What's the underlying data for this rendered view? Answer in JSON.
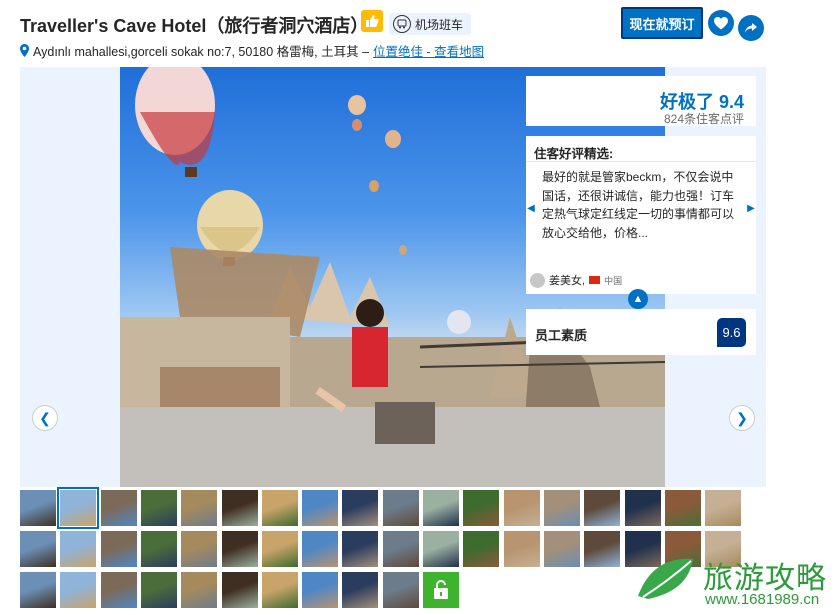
{
  "header": {
    "title": "Traveller's Cave Hotel（旅行者洞穴酒店）",
    "shuttle_label": "机场班车",
    "address": "Aydınlı mahallesi,gorceli sokak no:7, 50180 格雷梅, 土耳其 –",
    "address_link": "位置绝佳 - 查看地图",
    "book_button": "现在就预订"
  },
  "review_panel": {
    "score_label": "好极了 9.4",
    "review_count": "824条住客点评",
    "featured_heading": "住客好评精选:",
    "review_text": "最好的就是管家beckm，不仅会说中国话，还很讲诚信，能力也强！订车定热气球定红线定一切的事情都可以放心交给他，价格...",
    "reviewer_name": "姜美女,",
    "reviewer_country": "中国",
    "staff_label": "员工素质",
    "staff_score": "9.6"
  },
  "icons": [
    "thumbs-up-icon",
    "bus-icon",
    "location-pin-icon",
    "heart-icon",
    "share-icon",
    "chevron-left-icon",
    "chevron-right-icon",
    "chevron-up-icon",
    "lock-icon",
    "avatar-icon",
    "china-flag-icon"
  ],
  "colors": {
    "accent": "#0071c2",
    "dark_blue": "#003580",
    "badge_yellow": "#febb02",
    "lock_green": "#3eb32e",
    "panel_bg": "#ebf3ff"
  },
  "watermark": {
    "text": "旅游攻略",
    "url": "www.1681989.cn"
  }
}
